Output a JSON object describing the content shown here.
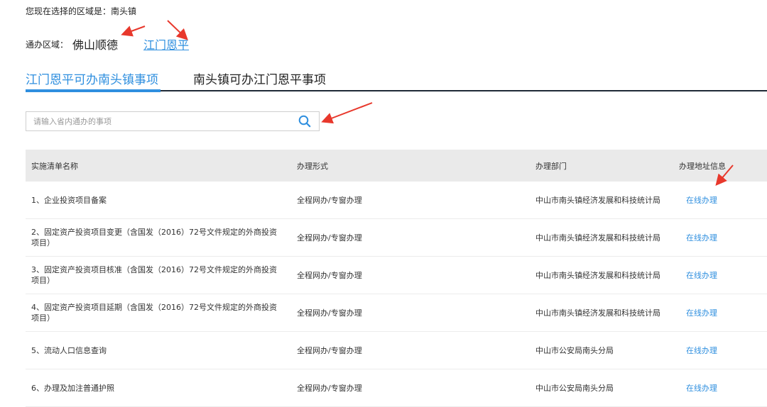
{
  "region": {
    "text": "您现在选择的区域是：南头镇"
  },
  "area": {
    "label": "通办区域：",
    "current": "佛山顺德",
    "link": "江门恩平"
  },
  "tabs": [
    {
      "label": "江门恩平可办南头镇事项",
      "active": true
    },
    {
      "label": "南头镇可办江门恩平事项",
      "active": false
    }
  ],
  "search": {
    "placeholder": "请输入省内通办的事项"
  },
  "table": {
    "headers": [
      "实施清单名称",
      "办理形式",
      "办理部门",
      "办理地址信息"
    ],
    "rows": [
      {
        "name": "1、企业投资项目备案",
        "form": "全程网办/专窗办理",
        "dept": "中山市南头镇经济发展和科技统计局",
        "action": "在线办理"
      },
      {
        "name": "2、固定资产投资项目变更（含国发（2016）72号文件规定的外商投资项目）",
        "form": "全程网办/专窗办理",
        "dept": "中山市南头镇经济发展和科技统计局",
        "action": "在线办理"
      },
      {
        "name": "3、固定资产投资项目核准（含国发（2016）72号文件规定的外商投资项目）",
        "form": "全程网办/专窗办理",
        "dept": "中山市南头镇经济发展和科技统计局",
        "action": "在线办理"
      },
      {
        "name": "4、固定资产投资项目延期（含国发（2016）72号文件规定的外商投资项目）",
        "form": "全程网办/专窗办理",
        "dept": "中山市南头镇经济发展和科技统计局",
        "action": "在线办理"
      },
      {
        "name": "5、流动人口信息查询",
        "form": "全程网办/专窗办理",
        "dept": "中山市公安局南头分局",
        "action": "在线办理"
      },
      {
        "name": "6、办理及加注普通护照",
        "form": "全程网办/专窗办理",
        "dept": "中山市公安局南头分局",
        "action": "在线办理"
      }
    ]
  },
  "colors": {
    "accent": "#2f8fdf",
    "arrow": "#e8382c",
    "header_bg": "#eaeaea"
  }
}
